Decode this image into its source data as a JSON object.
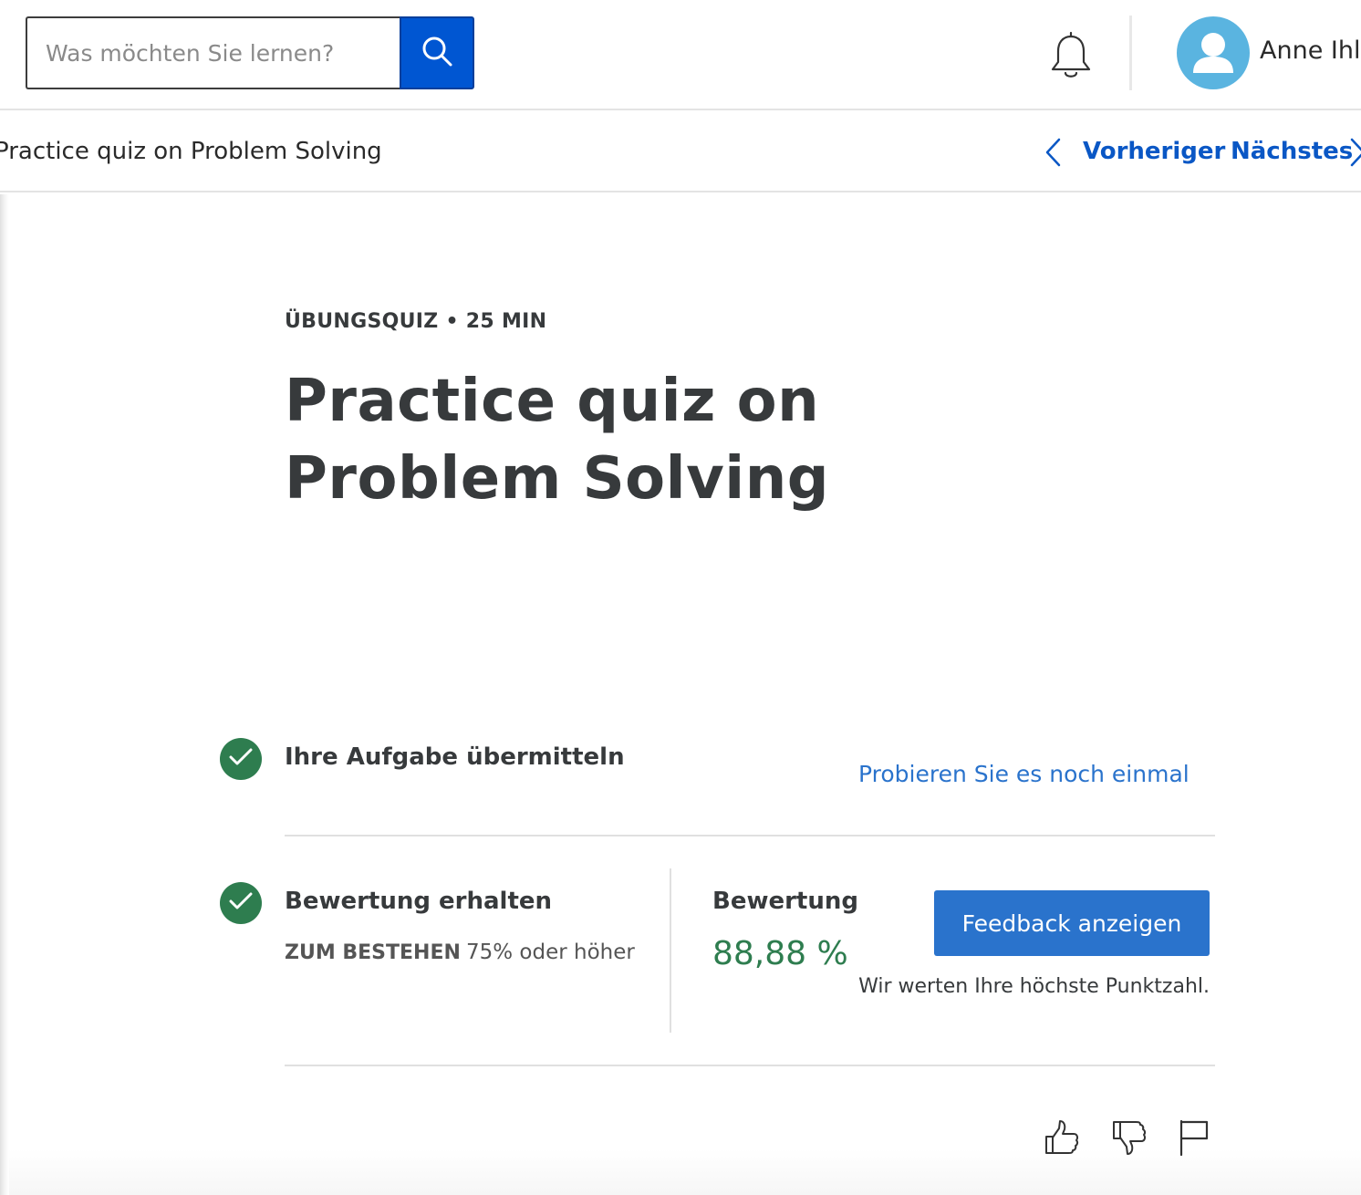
{
  "header": {
    "search": {
      "placeholder": "Was möchten Sie lernen?",
      "value": ""
    },
    "user_name": "Anne Ihle"
  },
  "subnav": {
    "item_title": "Practice quiz on Problem Solving",
    "prev_label": "Vorheriger",
    "next_label": "Nächstes"
  },
  "main": {
    "meta": "ÜBUNGSQUIZ • 25 MIN",
    "title": "Practice quiz on Problem Solving",
    "steps": {
      "submit": {
        "title": "Ihre Aufgabe übermitteln",
        "action_label": "Probieren Sie es noch einmal",
        "status": "complete"
      },
      "grade": {
        "title": "Bewertung erhalten",
        "pass_label": "ZUM BESTEHEN",
        "pass_value": "75% oder höher",
        "status": "complete",
        "grade_label": "Bewertung",
        "grade_value": "88,88 %",
        "feedback_button": "Feedback anzeigen",
        "note": "Wir werten Ihre höchste Punktzahl."
      }
    }
  },
  "icons": {
    "search": "search-icon",
    "bell": "bell-icon",
    "avatar": "user-avatar-icon",
    "prev": "chevron-left-icon",
    "next": "chevron-right-icon",
    "check": "check-icon",
    "like": "thumbs-up-icon",
    "dislike": "thumbs-down-icon",
    "flag": "flag-icon"
  },
  "colors": {
    "primary_blue": "#0056d2",
    "link_blue": "#2a73cc",
    "success_green": "#2e7d4f",
    "text_dark": "#373a3c",
    "avatar_bg": "#5ab4e0"
  }
}
